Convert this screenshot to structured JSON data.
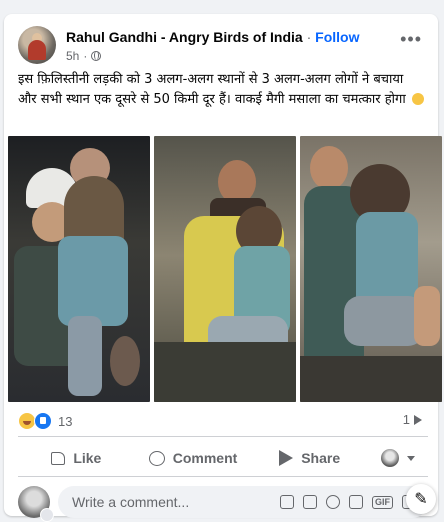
{
  "post": {
    "author": "Rahul Gandhi - Angry Birds of India",
    "separator": "·",
    "follow_label": "Follow",
    "time": "5h",
    "privacy_icon": "globe-icon",
    "more_label": "•••",
    "text": "इस फ़िलिस्तीनी लड़की को 3 अलग-अलग स्थानों से 3 अलग-अलग लोगों ने बचाया और सभी स्थान एक दूसरे से 50 किमी दूर हैं। वाकई मैगी मसाला का चमत्कार होगा",
    "text_emoji": "thinking-face-emoji"
  },
  "reactions": {
    "icons": [
      "haha-icon",
      "like-icon"
    ],
    "count": "13",
    "shares_count": "1"
  },
  "actions": {
    "like_label": "Like",
    "comment_label": "Comment",
    "share_label": "Share"
  },
  "compose": {
    "placeholder": "Write a comment...",
    "icons": [
      "sticker-icon",
      "avatar-sticker-icon",
      "emoji-icon",
      "camera-icon",
      "gif-icon",
      "label-icon"
    ]
  },
  "colors": {
    "accent": "#0866ff",
    "secondary_text": "#65676b",
    "background": "#f0f2f5"
  }
}
